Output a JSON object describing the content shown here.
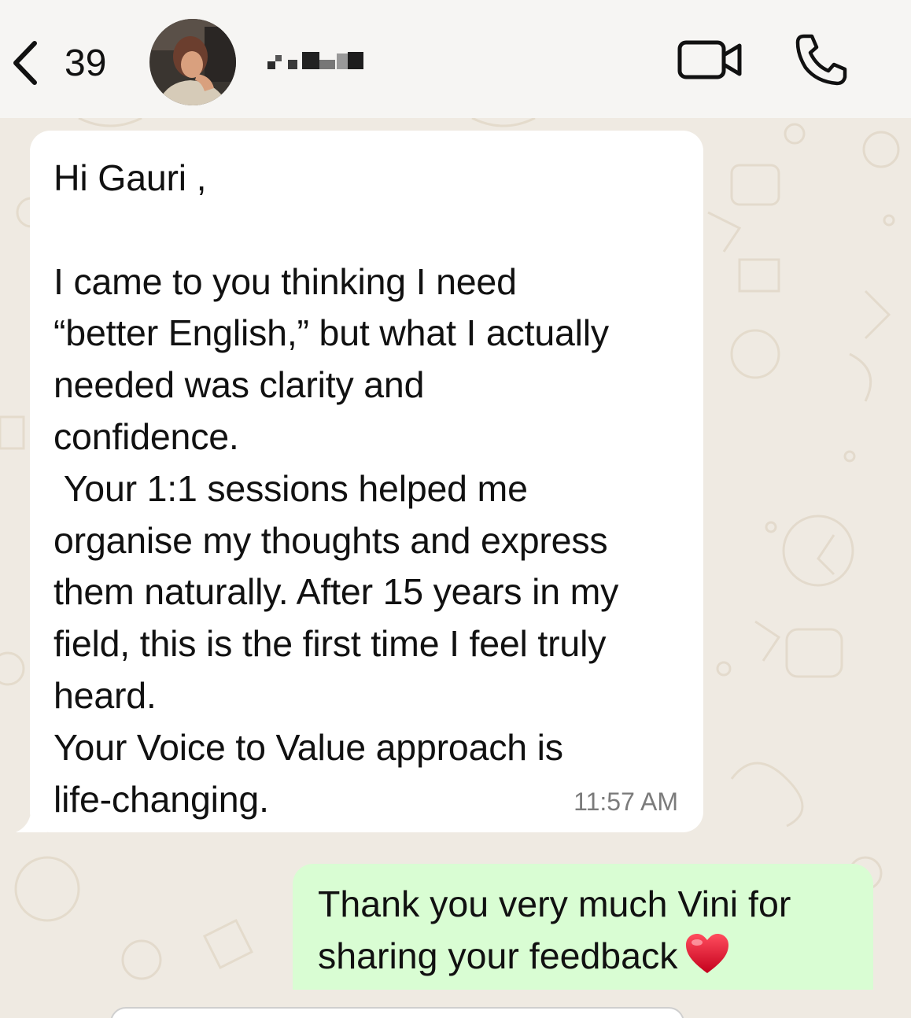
{
  "header": {
    "back_count": "39",
    "contact_name_blurred": "",
    "icons": {
      "back": "chevron-left-icon",
      "video": "video-camera-icon",
      "call": "phone-icon"
    }
  },
  "incoming_message": {
    "text": "Hi Gauri ,\n\nI came to you thinking I need\n“better English,” but what I actually\nneeded was clarity and\nconfidence.\n Your 1:1 sessions helped me\norganise my thoughts and express\nthem naturally. After 15 years in my\nfield, this is the first time I feel truly\nheard.\nYour Voice to Value approach is\nlife-changing.",
    "time": "11:57 AM"
  },
  "outgoing_message": {
    "text": "Thank you very much Vini for\nsharing your feedback",
    "emoji": "heart-icon"
  },
  "colors": {
    "header_bg": "#f6f5f3",
    "chat_bg": "#efeae2",
    "incoming_bubble": "#ffffff",
    "outgoing_bubble": "#d9fdd3",
    "time_text": "#7b7b7b"
  }
}
